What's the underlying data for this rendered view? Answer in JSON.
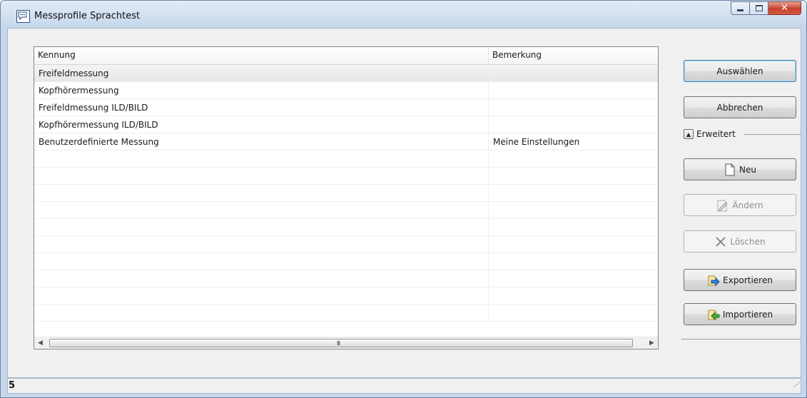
{
  "window": {
    "title": "Messprofile Sprachtest",
    "icon": "speech-bubble-icon",
    "controls": {
      "minimize": "minimize-icon",
      "maximize": "maximize-icon",
      "close": "close-icon"
    }
  },
  "list": {
    "columns": [
      "Kennung",
      "Bemerkung"
    ],
    "rows": [
      {
        "kennung": "Freifeldmessung",
        "bemerkung": "",
        "selected": true
      },
      {
        "kennung": "Kopfhörermessung",
        "bemerkung": ""
      },
      {
        "kennung": "Freifeldmessung ILD/BILD",
        "bemerkung": ""
      },
      {
        "kennung": "Kopfhörermessung  ILD/BILD",
        "bemerkung": ""
      },
      {
        "kennung": "Benutzerdefinierte Messung",
        "bemerkung": "Meine Einstellungen"
      },
      {
        "kennung": "",
        "bemerkung": ""
      },
      {
        "kennung": "",
        "bemerkung": ""
      },
      {
        "kennung": "",
        "bemerkung": ""
      },
      {
        "kennung": "",
        "bemerkung": ""
      },
      {
        "kennung": "",
        "bemerkung": ""
      },
      {
        "kennung": "",
        "bemerkung": ""
      },
      {
        "kennung": "",
        "bemerkung": ""
      },
      {
        "kennung": "",
        "bemerkung": ""
      },
      {
        "kennung": "",
        "bemerkung": ""
      },
      {
        "kennung": "",
        "bemerkung": ""
      }
    ],
    "scrollbar": {
      "left_icon": "scroll-left-icon",
      "right_icon": "scroll-right-icon",
      "grip": "III"
    }
  },
  "buttons": {
    "select": "Auswählen",
    "cancel": "Abbrechen",
    "expander": "Erweitert",
    "new": "Neu",
    "edit": "Ändern",
    "delete": "Löschen",
    "export": "Exportieren",
    "import": "Importieren"
  },
  "status": {
    "count": "5"
  }
}
